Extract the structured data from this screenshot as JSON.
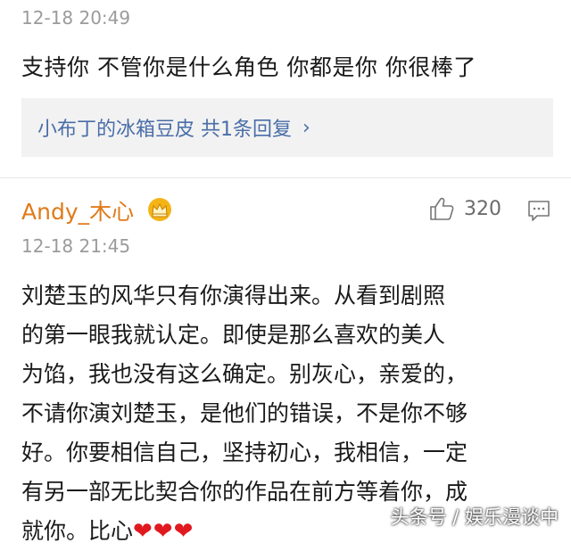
{
  "comment1": {
    "timestamp": "12-18 20:49",
    "text": "支持你 不管你是什么角色 你都是你 你很棒了",
    "reply_link": "小布丁的冰箱豆皮 共1条回复"
  },
  "comment2": {
    "username": "Andy_木心",
    "badge_icon": "crown-icon",
    "like_count": "320",
    "timestamp": "12-18 21:45",
    "lines": [
      "刘楚玉的风华只有你演得出来。从看到剧照",
      "的第一眼我就认定。即使是那么喜欢的美人",
      "为馅，我也没有这么确定。别灰心，亲爱的，",
      "不请你演刘楚玉，是他们的错误，不是你不够",
      "好。你要相信自己，坚持初心，我相信，一定",
      "有另一部无比契合你的作品在前方等着你，成"
    ],
    "last_line": "就你。比心",
    "hearts": "❤❤❤"
  },
  "watermark": "头条号 / 娱乐漫谈中",
  "colors": {
    "username": "#e07a1a",
    "reply_link": "#4a6ea8",
    "timestamp": "#9b9b9b",
    "heart": "#e0191f"
  }
}
